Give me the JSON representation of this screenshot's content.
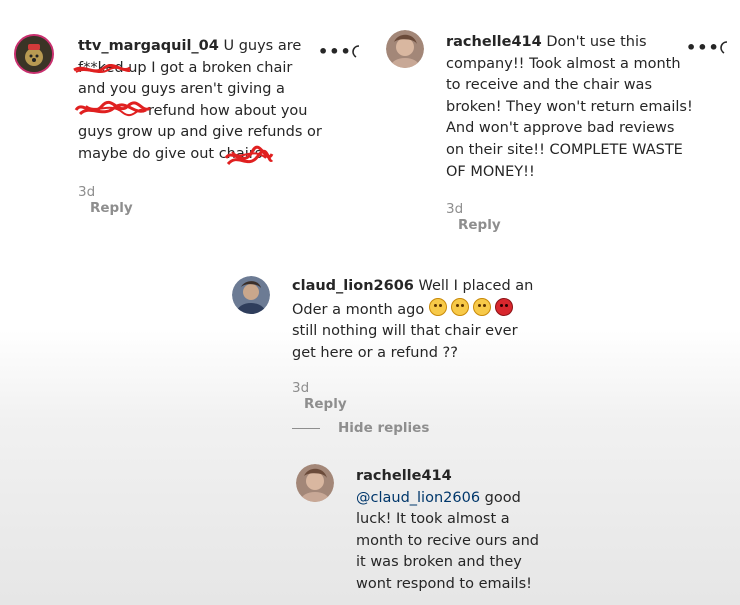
{
  "comments": [
    {
      "username": "ttv_margaquil_04",
      "lines": [
        "U guys are",
        "f**ked up I got a broken chair",
        "and you guys aren't giving a",
        "refund how about you",
        "guys grow up and give refunds or",
        "maybe do give out        chairs"
      ],
      "time": "3d",
      "reply_label": "Reply"
    },
    {
      "username": "rachelle414",
      "lines": [
        "Don't use this",
        "company!! Took almost a month",
        "to receive and the chair was",
        "broken! They won't return emails!",
        "And won't approve bad reviews",
        "on their site!! COMPLETE WASTE",
        "OF MONEY!!"
      ],
      "time": "3d",
      "reply_label": "Reply"
    },
    {
      "username": "claud_lion2606",
      "lines": [
        "Well I placed an",
        "Oder a month ago",
        "still nothing will that chair ever",
        "get here or a refund ??"
      ],
      "time": "3d",
      "reply_label": "Reply"
    },
    {
      "username": "rachelle414",
      "mention": "@claud_lion2606",
      "lines": [
        "good",
        "luck! It took almost a",
        "month to recive ours and",
        "it was broken and they",
        "wont respond to emails!"
      ]
    }
  ],
  "hide_replies_label": "Hide replies",
  "more_icon_label": "•••",
  "colors": {
    "scribble": "#e02020",
    "meta": "#8e8e8e",
    "mention": "#00376b"
  }
}
